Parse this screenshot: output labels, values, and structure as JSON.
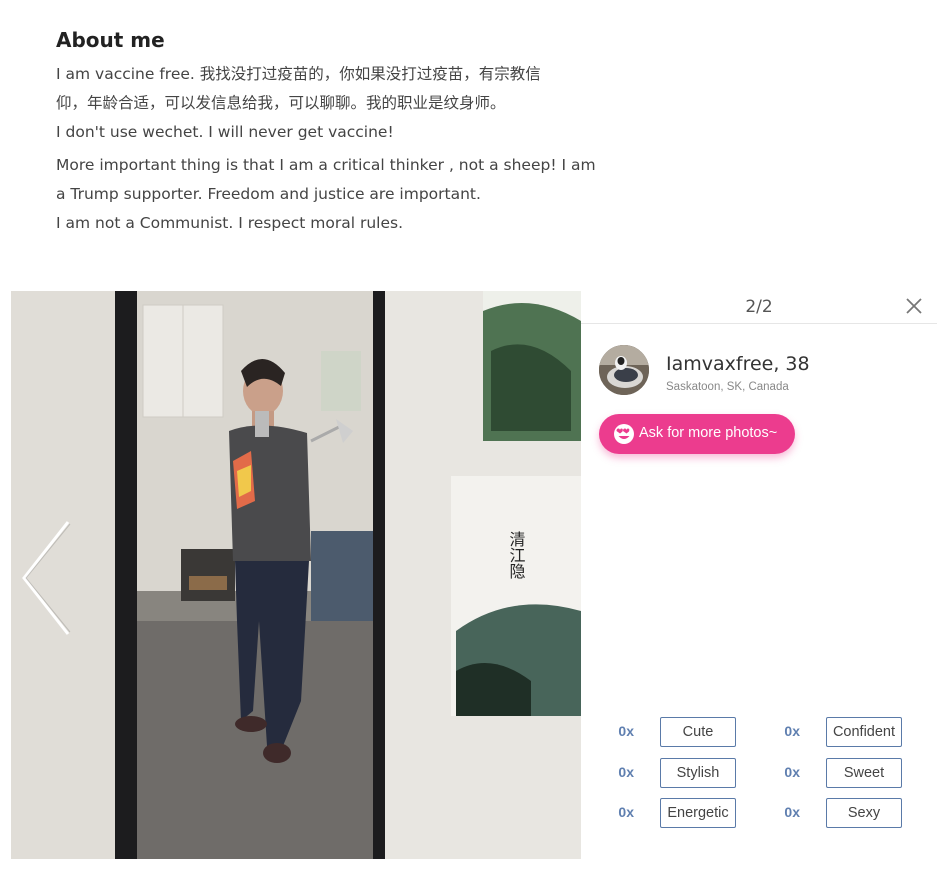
{
  "about": {
    "title": "About me",
    "para1_line1": "I am vaccine free. 我找没打过疫苗的，你如果没打过疫苗，有宗教信",
    "para1_line2": "仰，年龄合适，可以发信息给我，可以聊聊。我的职业是纹身师。",
    "para1_line3": "I don't use wechet. I will never get vaccine!",
    "para2_line1": "More important thing is that I am a critical thinker , not a sheep! I am",
    "para2_line2": "a Trump supporter. Freedom and justice are important.",
    "para2_line3": "I am not a Communist. I respect moral rules."
  },
  "viewer": {
    "counter": "2/2",
    "close_icon": "close-icon",
    "prev_icon": "chevron-left-icon"
  },
  "profile": {
    "name": "Iamvaxfree, 38",
    "location": "Saskatoon, SK, Canada"
  },
  "ask_button": {
    "label": "Ask for more photos~",
    "icon": "heart-eyes-emoji-icon",
    "color": "#ec3c8e"
  },
  "tags": [
    {
      "count": "0x",
      "label": "Cute"
    },
    {
      "count": "0x",
      "label": "Confident"
    },
    {
      "count": "0x",
      "label": "Stylish"
    },
    {
      "count": "0x",
      "label": "Sweet"
    },
    {
      "count": "0x",
      "label": "Energetic"
    },
    {
      "count": "0x",
      "label": "Sexy"
    }
  ],
  "colors": {
    "tag_border": "#5a7aa8",
    "tag_count": "#5f7fb0"
  }
}
